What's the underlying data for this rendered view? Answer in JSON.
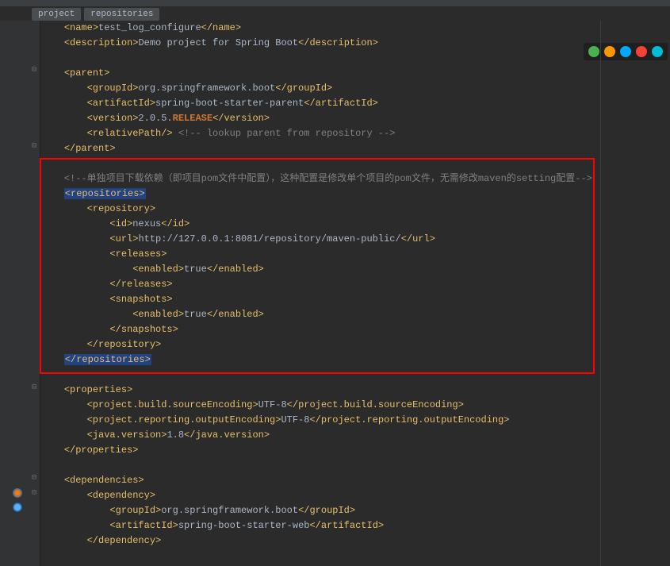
{
  "breadcrumb": {
    "project": "project",
    "repositories": "repositories"
  },
  "browser_icons": {
    "chrome": "#4caf50",
    "firefox": "#ff9800",
    "safari": "#03a9f4",
    "opera": "#f44336",
    "edge": "#00bcd4"
  },
  "colors": {
    "bg": "#2b2b2b",
    "gutter": "#313335",
    "tag": "#e8bf6a",
    "text": "#a9b7c6",
    "comment": "#808080",
    "keyword": "#cc7832",
    "highlight_bg": "#214283",
    "red": "#ff0000"
  },
  "code": {
    "l0": {
      "t1": "<name>",
      "v": "test_log_configure",
      "t2": "</name>"
    },
    "l1": {
      "t1": "<description>",
      "v": "Demo project for Spring Boot",
      "t2": "</description>"
    },
    "l2": "",
    "l3": {
      "t": "<parent>"
    },
    "l4": {
      "t1": "<groupId>",
      "v": "org.springframework.boot",
      "t2": "</groupId>"
    },
    "l5": {
      "t1": "<artifactId>",
      "v": "spring-boot-starter-parent",
      "t2": "</artifactId>"
    },
    "l6": {
      "t1": "<version>",
      "v1": "2.0.5.",
      "kw": "RELEASE",
      "t2": "</version>"
    },
    "l7": {
      "t": "<relativePath/>",
      "cm": " <!-- lookup parent from repository -->"
    },
    "l8": {
      "t": "</parent>"
    },
    "l9": "",
    "l10": {
      "cm": "<!--单独项目下载依赖（即项目pom文件中配置），这种配置是修改单个项目的pom文件，无需修改maven的setting配置-->"
    },
    "l11": {
      "h": "<repositories>"
    },
    "l12": {
      "t": "<repository>"
    },
    "l13": {
      "t1": "<id>",
      "v": "nexus",
      "t2": "</id>"
    },
    "l14": {
      "t1": "<url>",
      "v": "http://127.0.0.1:8081/repository/maven-public/",
      "t2": "</url>"
    },
    "l15": {
      "t": "<releases>"
    },
    "l16": {
      "t1": "<enabled>",
      "v": "true",
      "t2": "</enabled>"
    },
    "l17": {
      "t": "</releases>"
    },
    "l18": {
      "t": "<snapshots>"
    },
    "l19": {
      "t1": "<enabled>",
      "v": "true",
      "t2": "</enabled>"
    },
    "l20": {
      "t": "</snapshots>"
    },
    "l21": {
      "t": "</repository>"
    },
    "l22": {
      "h": "</repositories>"
    },
    "l23": "",
    "l24": {
      "t": "<properties>"
    },
    "l25": {
      "t1": "<project.build.sourceEncoding>",
      "v": "UTF-8",
      "t2": "</project.build.sourceEncoding>"
    },
    "l26": {
      "t1": "<project.reporting.outputEncoding>",
      "v": "UTF-8",
      "t2": "</project.reporting.outputEncoding>"
    },
    "l27": {
      "t1": "<java.version>",
      "v": "1.8",
      "t2": "</java.version>"
    },
    "l28": {
      "t": "</properties>"
    },
    "l29": "",
    "l30": {
      "t": "<dependencies>"
    },
    "l31": {
      "t": "<dependency>"
    },
    "l32": {
      "t1": "<groupId>",
      "v": "org.springframework.boot",
      "t2": "</groupId>"
    },
    "l33": {
      "t1": "<artifactId>",
      "v": "spring-boot-starter-web",
      "t2": "</artifactId>"
    },
    "l34": {
      "t": "</dependency>"
    },
    "l35": ""
  }
}
